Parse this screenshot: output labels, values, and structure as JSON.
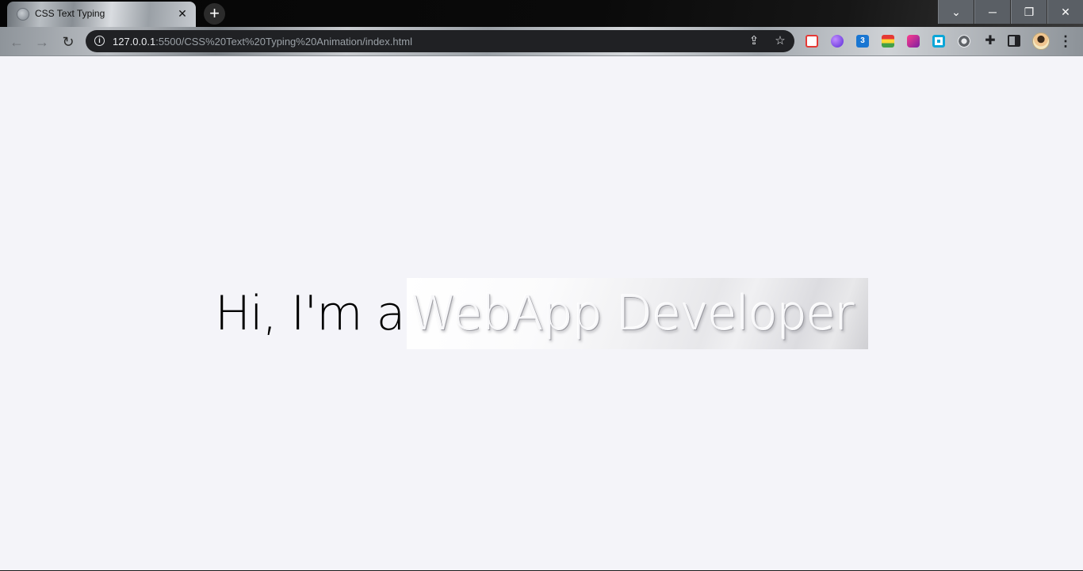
{
  "browser": {
    "tab": {
      "title": "CSS Text Typing",
      "close_glyph": "✕"
    },
    "new_tab_glyph": "+",
    "window_controls": {
      "tab_search": "⌄",
      "minimize": "─",
      "restore": "❐",
      "close": "✕"
    },
    "address_bar": {
      "host": "127.0.0.1",
      "path": ":5500/CSS%20Text%20Typing%20Animation/index.html"
    },
    "nav": {
      "back": "←",
      "forward": "→",
      "reload": "↻"
    },
    "extensions": [
      "calendar-ext-icon",
      "purple-orb-ext-icon",
      "css3-ext-icon",
      "color-bars-ext-icon",
      "pink-ext-icon",
      "window-ext-icon",
      "gear-ext-icon"
    ],
    "ext_css_label": "3"
  },
  "page": {
    "greeting": "Hi, I'm a",
    "typed_role": "WebApp Developer"
  },
  "colors": {
    "page_background": "#f4f4f9",
    "omnibox": "#202124",
    "text": "#000000"
  }
}
